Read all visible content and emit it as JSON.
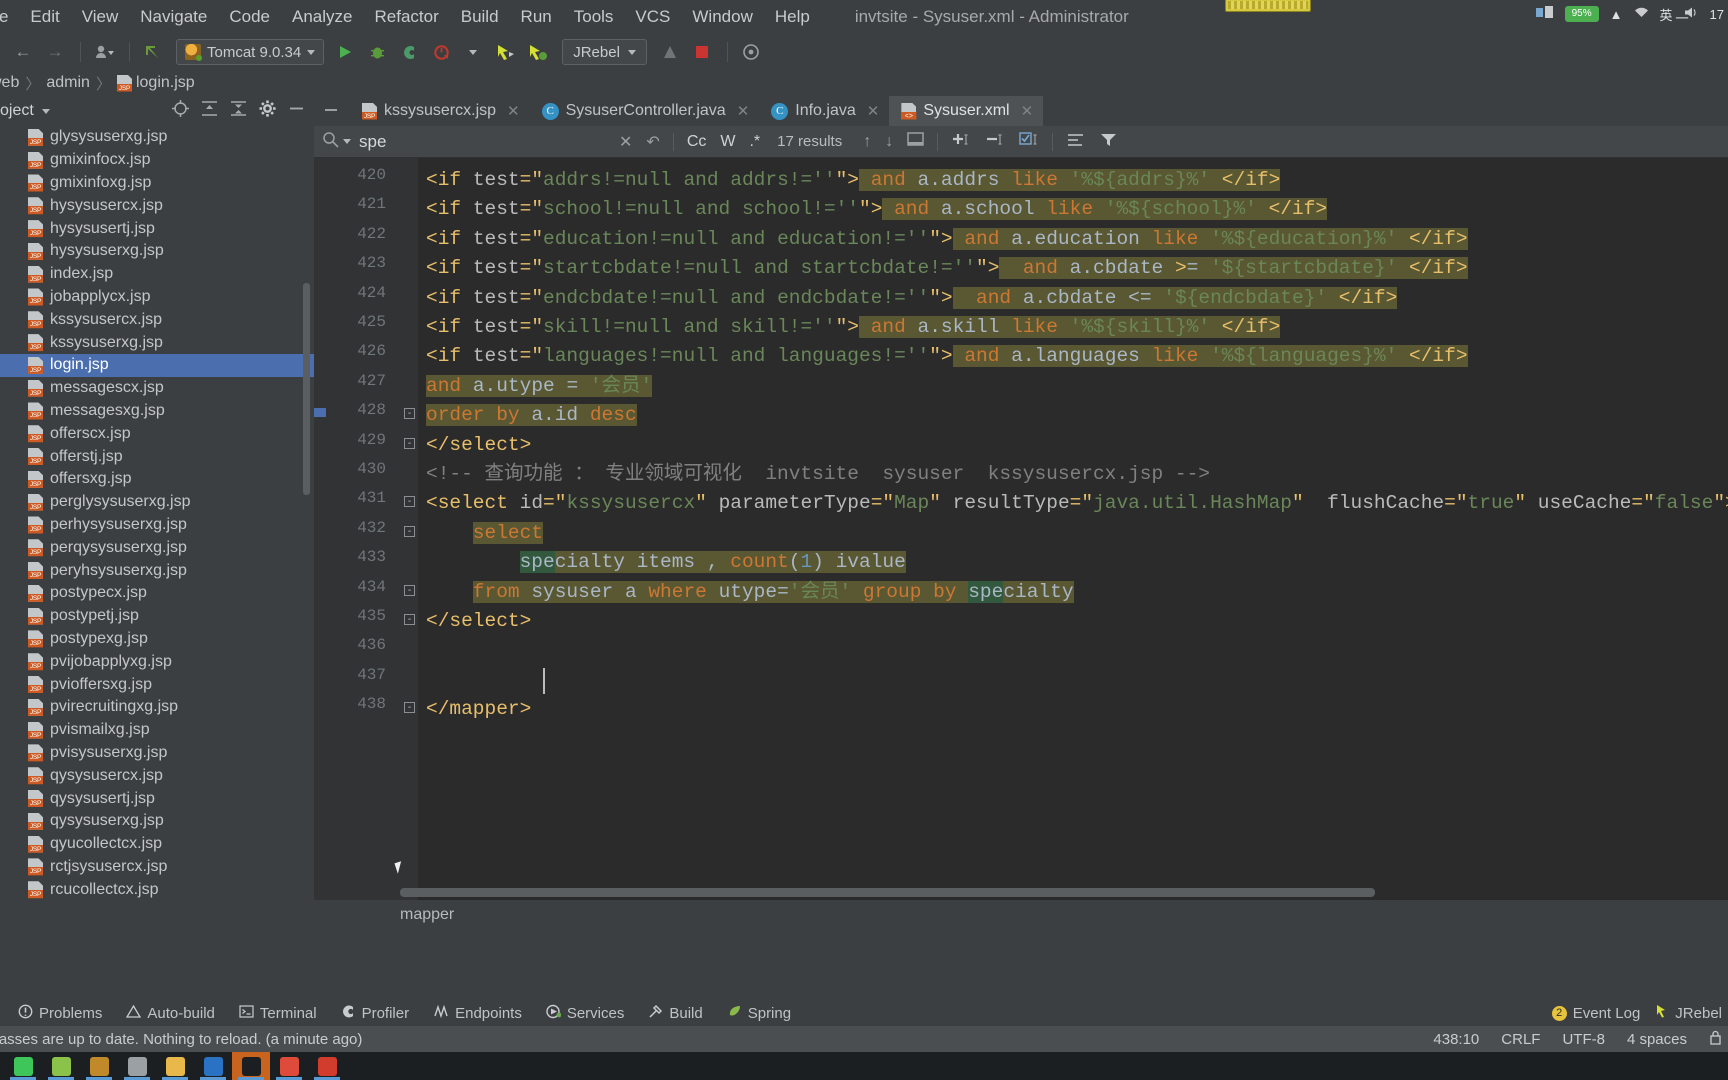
{
  "window": {
    "title": "invtsite - Sysuser.xml - Administrator",
    "minimize_label": "─",
    "menus": [
      {
        "label": "File",
        "mnemonic": "F"
      },
      {
        "label": "Edit",
        "mnemonic": "E"
      },
      {
        "label": "View",
        "mnemonic": "V"
      },
      {
        "label": "Navigate",
        "mnemonic": "N"
      },
      {
        "label": "Code",
        "mnemonic": "C"
      },
      {
        "label": "Analyze",
        "mnemonic": "z"
      },
      {
        "label": "Refactor",
        "mnemonic": "R"
      },
      {
        "label": "Build",
        "mnemonic": "B"
      },
      {
        "label": "Run",
        "mnemonic": "u"
      },
      {
        "label": "Tools",
        "mnemonic": "T"
      },
      {
        "label": "VCS",
        "mnemonic": "S"
      },
      {
        "label": "Window",
        "mnemonic": "W"
      },
      {
        "label": "Help",
        "mnemonic": "H"
      }
    ]
  },
  "toolbar": {
    "back_icon": "back-arrow-icon",
    "forward_icon": "forward-arrow-icon",
    "profile_icon": "user-profile-icon",
    "revert_icon": "revert-arrow-icon",
    "run_config": "Tomcat 9.0.34",
    "run_icon": "run-play-icon",
    "debug_icon": "debug-bug-icon",
    "run_coverage_icon": "run-with-coverage-icon",
    "profile_run_icon": "profile-clock-icon",
    "jrebel_run_icon": "jrebel-run-icon",
    "jrebel_debug_icon": "jrebel-debug-icon",
    "jrebel_label": "JRebel",
    "stop_icon": "stop-square-icon",
    "search_everywhere_icon": "search-everywhere-icon"
  },
  "breadcrumb": {
    "items": [
      "web",
      "admin",
      "login.jsp"
    ],
    "separator": "〉"
  },
  "project_panel": {
    "title": "Project",
    "actions": [
      "locate-icon",
      "expand-all-icon",
      "collapse-all-icon",
      "settings-gear-icon",
      "hide-icon"
    ],
    "files": [
      {
        "name": "glysysuserxg.jsp",
        "selected": false
      },
      {
        "name": "gmixinfocx.jsp",
        "selected": false
      },
      {
        "name": "gmixinfoxg.jsp",
        "selected": false
      },
      {
        "name": "hysysusercx.jsp",
        "selected": false
      },
      {
        "name": "hysysusertj.jsp",
        "selected": false
      },
      {
        "name": "hysysuserxg.jsp",
        "selected": false
      },
      {
        "name": "index.jsp",
        "selected": false
      },
      {
        "name": "jobapplycx.jsp",
        "selected": false
      },
      {
        "name": "kssysusercx.jsp",
        "selected": false
      },
      {
        "name": "kssysuserxg.jsp",
        "selected": false
      },
      {
        "name": "login.jsp",
        "selected": true
      },
      {
        "name": "messagescx.jsp",
        "selected": false
      },
      {
        "name": "messagesxg.jsp",
        "selected": false
      },
      {
        "name": "offerscx.jsp",
        "selected": false
      },
      {
        "name": "offerstj.jsp",
        "selected": false
      },
      {
        "name": "offersxg.jsp",
        "selected": false
      },
      {
        "name": "perglysysuserxg.jsp",
        "selected": false
      },
      {
        "name": "perhysysuserxg.jsp",
        "selected": false
      },
      {
        "name": "perqysysuserxg.jsp",
        "selected": false
      },
      {
        "name": "peryhsysuserxg.jsp",
        "selected": false
      },
      {
        "name": "postypecx.jsp",
        "selected": false
      },
      {
        "name": "postypetj.jsp",
        "selected": false
      },
      {
        "name": "postypexg.jsp",
        "selected": false
      },
      {
        "name": "pvijobapplyxg.jsp",
        "selected": false
      },
      {
        "name": "pvioffersxg.jsp",
        "selected": false
      },
      {
        "name": "pvirecruitingxg.jsp",
        "selected": false
      },
      {
        "name": "pvismailxg.jsp",
        "selected": false
      },
      {
        "name": "pvisysuserxg.jsp",
        "selected": false
      },
      {
        "name": "qysysusercx.jsp",
        "selected": false
      },
      {
        "name": "qysysusertj.jsp",
        "selected": false
      },
      {
        "name": "qysysuserxg.jsp",
        "selected": false
      },
      {
        "name": "qyucollectcx.jsp",
        "selected": false
      },
      {
        "name": "rctjsysusercx.jsp",
        "selected": false
      },
      {
        "name": "rcucollectcx.jsp",
        "selected": false
      }
    ]
  },
  "editor_tabs": [
    {
      "label": "kssysusercx.jsp",
      "icon": "jsp-file-icon",
      "active": false
    },
    {
      "label": "SysuserController.java",
      "icon": "java-class-icon",
      "active": false
    },
    {
      "label": "Info.java",
      "icon": "java-class-icon",
      "active": false
    },
    {
      "label": "Sysuser.xml",
      "icon": "xml-file-icon",
      "active": true
    }
  ],
  "find_bar": {
    "query": "spe",
    "results": "17 results",
    "match_case": "Cc",
    "words": "W",
    "regex": ".*",
    "prev_icon": "arrow-up-icon",
    "next_icon": "arrow-down-icon",
    "select_all_icon": "select-all-icon",
    "add_icon": "add-line-icon",
    "remove_icon": "remove-line-icon",
    "select_occurrences_icon": "select-occurrences-icon",
    "filter_icon": "filter-icon",
    "preserve_case_icon": "preserve-case-icon",
    "close_icon": "close-x-icon",
    "history_icon": "history-icon"
  },
  "editor": {
    "bottom_breadcrumb": "mapper",
    "first_line": 420,
    "lines": [
      {
        "n": 420,
        "code": "<if test=\"addrs!=null and addrs!=''\"> and a.addrs like '%${addrs}%' </if>"
      },
      {
        "n": 421,
        "code": "<if test=\"school!=null and school!=''\"> and a.school like '%${school}%' </if>"
      },
      {
        "n": 422,
        "code": "<if test=\"education!=null and education!=''\"> and a.education like '%${education}%' </if>"
      },
      {
        "n": 423,
        "code": "<if test=\"startcbdate!=null and startcbdate!=''\">  and a.cbdate >= '${startcbdate}' </if>"
      },
      {
        "n": 424,
        "code": "<if test=\"endcbdate!=null and endcbdate!=''\">  and a.cbdate <= '${endcbdate}' </if>"
      },
      {
        "n": 425,
        "code": "<if test=\"skill!=null and skill!=''\"> and a.skill like '%${skill}%' </if>"
      },
      {
        "n": 426,
        "code": "<if test=\"languages!=null and languages!=''\"> and a.languages like '%${languages}%' </if>"
      },
      {
        "n": 427,
        "code": "and a.utype = '会员'"
      },
      {
        "n": 428,
        "code": "order by a.id desc"
      },
      {
        "n": 429,
        "code": "</select>"
      },
      {
        "n": 430,
        "code": "<!-- 查询功能 ： 专业领域可视化  invtsite  sysuser  kssysusercx.jsp -->"
      },
      {
        "n": 431,
        "code": "<select id=\"kssysusercx\" parameterType=\"Map\" resultType=\"java.util.HashMap\"  flushCache=\"true\" useCache=\"false\">"
      },
      {
        "n": 432,
        "code": "    select"
      },
      {
        "n": 433,
        "code": "        specialty items , count(1) ivalue"
      },
      {
        "n": 434,
        "code": "    from sysuser a where utype='会员' group by specialty"
      },
      {
        "n": 435,
        "code": "</select>"
      },
      {
        "n": 436,
        "code": ""
      },
      {
        "n": 437,
        "code": ""
      },
      {
        "n": 438,
        "code": "</mapper>"
      }
    ]
  },
  "tool_windows": [
    {
      "label": "Problems",
      "icon": "problems-icon"
    },
    {
      "label": "Auto-build",
      "icon": "auto-build-icon"
    },
    {
      "label": "Terminal",
      "icon": "terminal-icon"
    },
    {
      "label": "Profiler",
      "icon": "profiler-icon"
    },
    {
      "label": "Endpoints",
      "icon": "endpoints-icon"
    },
    {
      "label": "Services",
      "icon": "services-icon"
    },
    {
      "label": "Build",
      "icon": "build-hammer-icon"
    },
    {
      "label": "Spring",
      "icon": "spring-leaf-icon"
    }
  ],
  "status": {
    "notification": "classes are up to date. Nothing to reload. (a minute ago)",
    "event_log": "Event Log",
    "event_count": "2",
    "jrebel_status": "JRebel",
    "caret_position": "438:10",
    "line_separator": "CRLF",
    "encoding": "UTF-8",
    "indent": "4 spaces",
    "lock_icon": "lock-icon"
  },
  "taskbar": {
    "apps": [
      {
        "name": "wechat-icon",
        "color": "#3ec65a",
        "active": false
      },
      {
        "name": "qq-browser-icon",
        "color": "#8bc34a",
        "active": false
      },
      {
        "name": "firefox-icon",
        "color": "#c08a2a",
        "active": false
      },
      {
        "name": "sql-tool-icon",
        "color": "#9aa0a3",
        "active": false
      },
      {
        "name": "file-explorer-icon",
        "color": "#e8b84b",
        "active": false
      },
      {
        "name": "wps-writer-icon",
        "color": "#2a73c4",
        "active": false
      },
      {
        "name": "intellij-idea-icon",
        "color": "#1c1f22",
        "active": true
      },
      {
        "name": "chrome-icon",
        "color": "#de4b3a",
        "active": false
      },
      {
        "name": "pdf-reader-icon",
        "color": "#d23c2c",
        "active": false
      }
    ],
    "tray": {
      "battery_percent": "95%",
      "show_hidden_icon": "chevron-up-icon",
      "network_icon": "network-icon",
      "ime_label": "英",
      "volume_icon": "volume-icon",
      "clock": "17"
    }
  }
}
